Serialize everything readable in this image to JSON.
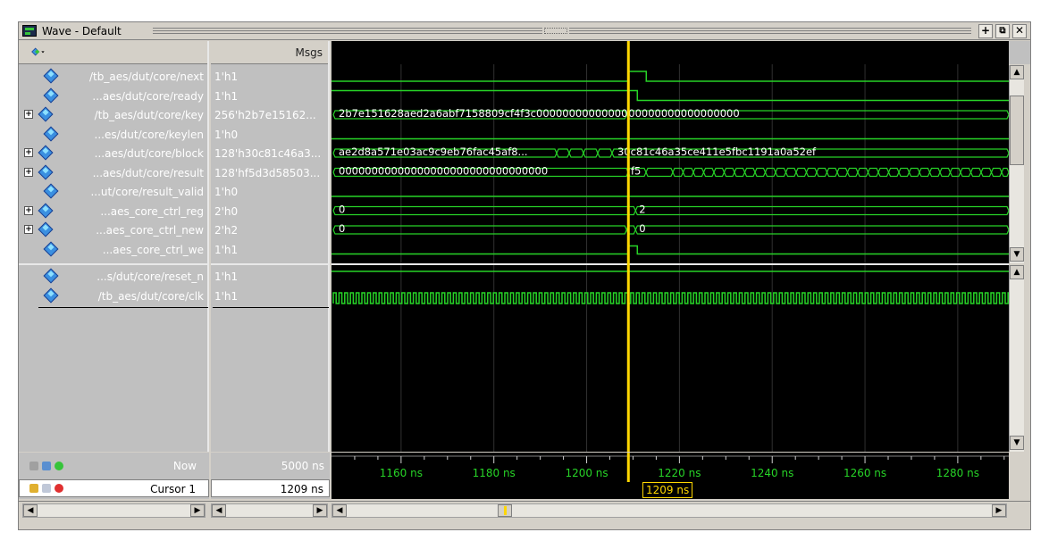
{
  "window": {
    "title": "Wave - Default",
    "buttons": {
      "dock": "+",
      "undock": "⧉",
      "close": "✕"
    }
  },
  "header": {
    "msgs_label": "Msgs"
  },
  "signals_top": [
    {
      "name": "/tb_aes/dut/core/next",
      "value": "1'h1",
      "expandable": false,
      "icon": "input-diamond-icon"
    },
    {
      "name": "...aes/dut/core/ready",
      "value": "1'h1",
      "expandable": false,
      "icon": "output-diamond-icon"
    },
    {
      "name": "/tb_aes/dut/core/key",
      "value": "256'h2b7e15162...",
      "expandable": true,
      "icon": "input-diamond-icon"
    },
    {
      "name": "...es/dut/core/keylen",
      "value": "1'h0",
      "expandable": false,
      "icon": "input-diamond-icon"
    },
    {
      "name": "...aes/dut/core/block",
      "value": "128'h30c81c46a3...",
      "expandable": true,
      "icon": "input-diamond-icon"
    },
    {
      "name": "...aes/dut/core/result",
      "value": "128'hf5d3d58503...",
      "expandable": true,
      "icon": "output-diamond-icon"
    },
    {
      "name": "...ut/core/result_valid",
      "value": "1'h0",
      "expandable": false,
      "icon": "output-diamond-icon"
    },
    {
      "name": "...aes_core_ctrl_reg",
      "value": "2'h0",
      "expandable": true,
      "icon": "internal-diamond-icon"
    },
    {
      "name": "...aes_core_ctrl_new",
      "value": "2'h2",
      "expandable": true,
      "icon": "internal-diamond-icon"
    },
    {
      "name": "...aes_core_ctrl_we",
      "value": "1'h1",
      "expandable": false,
      "icon": "internal-diamond-icon"
    }
  ],
  "signals_bottom": [
    {
      "name": "...s/dut/core/reset_n",
      "value": "1'h1",
      "icon": "input-diamond-icon"
    },
    {
      "name": "/tb_aes/dut/core/clk",
      "value": "1'h1",
      "icon": "input-diamond-icon"
    }
  ],
  "bus_labels": {
    "key_before": "2b7e151628aed2a6abf7158809cf4f3c00000000000000",
    "key_after": "00000000000000000",
    "block_before": "ae2d8a571e03ac9c9eb76fac45af8...",
    "block_after": "30c81c46a35ce411e5fbc1191a0a52ef",
    "result_before": "00000000000000000000000000000000",
    "result_after": "f5",
    "ctrl_reg_before": "0",
    "ctrl_reg_after": "2",
    "ctrl_new_before": "0",
    "ctrl_new_after": "0"
  },
  "timeline": {
    "now_label": "Now",
    "now_value": "5000 ns",
    "cursor_label": "Cursor 1",
    "cursor_value": "1209 ns",
    "cursor_tag": "1209 ns",
    "ticks": [
      "1160 ns",
      "1180 ns",
      "1200 ns",
      "1220 ns",
      "1240 ns",
      "1260 ns",
      "1280 ns"
    ],
    "view_start_ns": 1145,
    "view_end_ns": 1291,
    "cursor_ns": 1209
  },
  "colors": {
    "wave": "#27d327",
    "cursor": "#ffd700",
    "grid": "#303030",
    "background": "#000000"
  }
}
